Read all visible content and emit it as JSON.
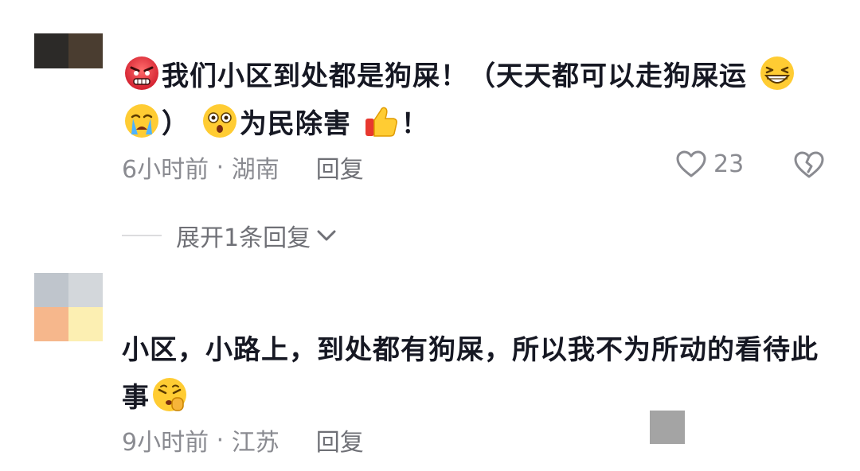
{
  "comments": [
    {
      "avatar_colors": [
        "#2c2a28",
        "#4a3d30"
      ],
      "text_parts": {
        "a": "我们小区到处都是狗屎！（天天都可以走狗屎运",
        "b": "）",
        "c": "为民除害",
        "d": "！"
      },
      "emojis": [
        "angry-face-icon",
        "grinning-squint-face-icon",
        "crying-face-icon",
        "astonished-face-icon",
        "thumbs-up-icon"
      ],
      "time": "6小时前",
      "location": "湖南",
      "reply_label": "回复",
      "like_count": "23"
    },
    {
      "avatar_colors": [
        "#bfc5cc",
        "#d3d7db",
        "#f6b78c",
        "#fcefb2"
      ],
      "text_parts": {
        "a": "小区，小路上，到处都有狗屎，所以我不为所动的看待此事"
      },
      "emojis": [
        "shushing-face-icon"
      ],
      "time": "9小时前",
      "location": "江苏",
      "reply_label": "回复"
    }
  ],
  "expand_replies_label": "展开1条回复",
  "colors": {
    "text": "#161823",
    "meta": "#8a8b91",
    "emoji_yellow": "#ffcc33"
  }
}
